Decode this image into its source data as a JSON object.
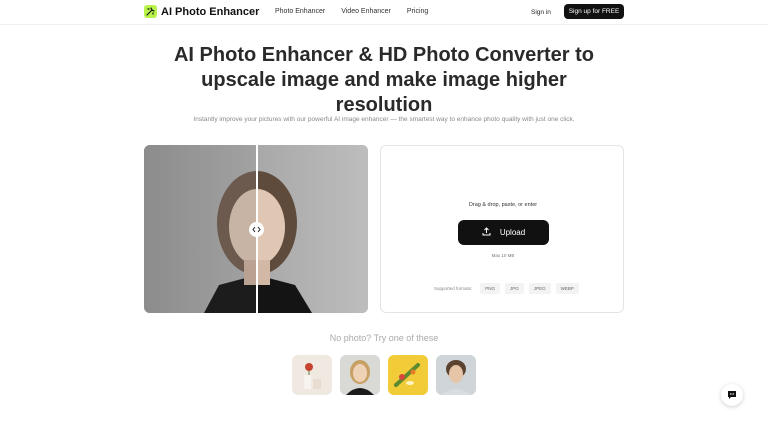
{
  "header": {
    "brand": "AI Photo Enhancer",
    "nav": [
      "Photo Enhancer",
      "Video Enhancer",
      "Pricing"
    ],
    "signin_label": "Sign in",
    "signup_label": "Sign up for FREE"
  },
  "hero": {
    "title_line1": "AI Photo Enhancer & HD Photo Converter to",
    "title_line2": "upscale image and make image higher",
    "title_line3": "resolution",
    "subtitle": "Instantly improve your pictures with our powerful AI image enhancer — the smartest way to enhance photo quality with just one click."
  },
  "compare": {
    "handle_icon": "arrows-horizontal-icon"
  },
  "upload": {
    "hint": "Drag & drop, paste, or enter",
    "button_label": "Upload",
    "max_size": "Max 10 MB",
    "formats_label": "Supported formats:",
    "formats": [
      "PNG",
      "JPG",
      "JPEG",
      "WEBP"
    ]
  },
  "samples": {
    "title": "No photo? Try one of these"
  },
  "colors": {
    "accent": "#b7f34a",
    "primary": "#111111"
  }
}
